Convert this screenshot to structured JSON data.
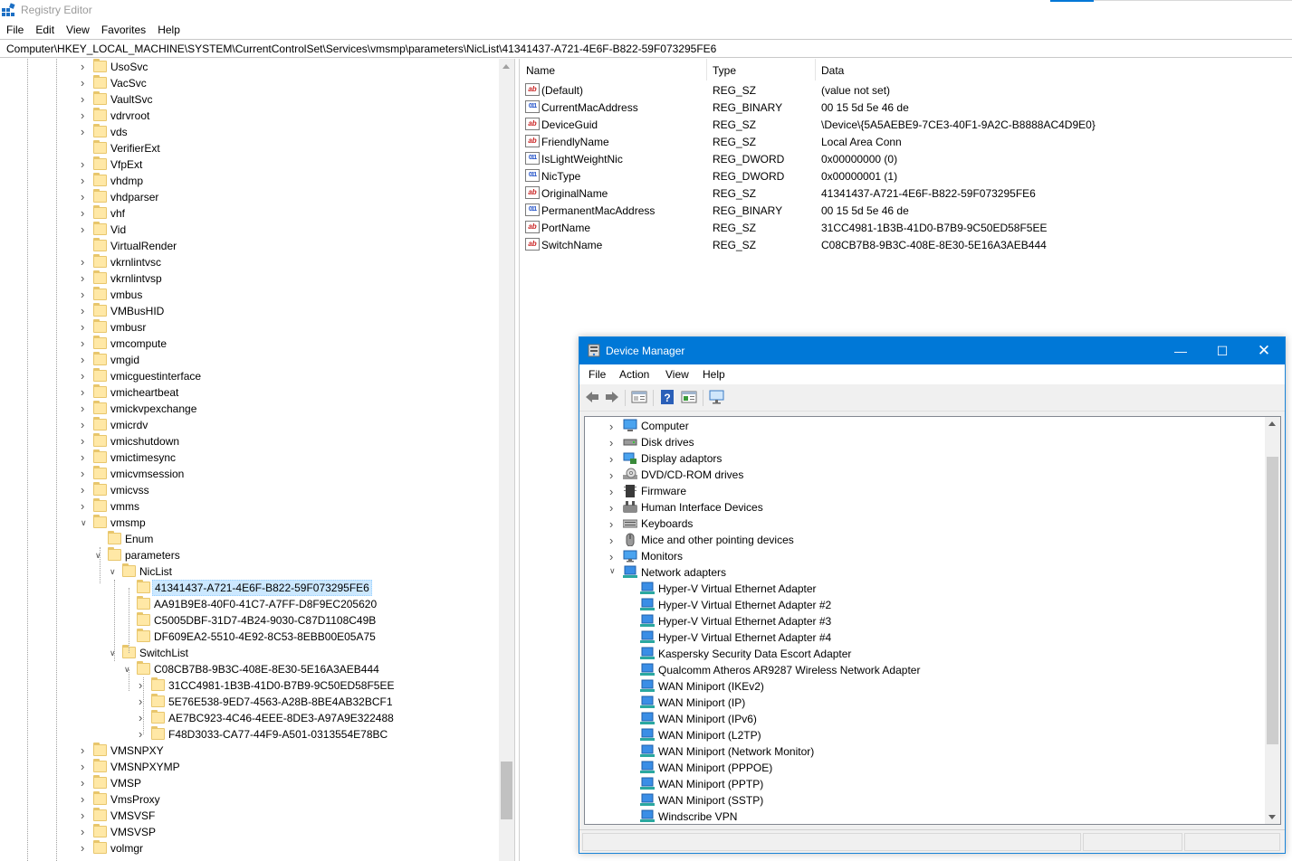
{
  "registry": {
    "title": "Registry Editor",
    "menu": [
      "File",
      "Edit",
      "View",
      "Favorites",
      "Help"
    ],
    "address": "Computer\\HKEY_LOCAL_MACHINE\\SYSTEM\\CurrentControlSet\\Services\\vmsmp\\parameters\\NicList\\41341437-A721-4E6F-B822-59F073295FE6",
    "tree": [
      {
        "label": "UsoSvc",
        "level": 0,
        "exp": "right"
      },
      {
        "label": "VacSvc",
        "level": 0,
        "exp": "right"
      },
      {
        "label": "VaultSvc",
        "level": 0,
        "exp": "right"
      },
      {
        "label": "vdrvroot",
        "level": 0,
        "exp": "right"
      },
      {
        "label": "vds",
        "level": 0,
        "exp": "right"
      },
      {
        "label": "VerifierExt",
        "level": 0,
        "exp": "none"
      },
      {
        "label": "VfpExt",
        "level": 0,
        "exp": "right"
      },
      {
        "label": "vhdmp",
        "level": 0,
        "exp": "right"
      },
      {
        "label": "vhdparser",
        "level": 0,
        "exp": "right"
      },
      {
        "label": "vhf",
        "level": 0,
        "exp": "right"
      },
      {
        "label": "Vid",
        "level": 0,
        "exp": "right"
      },
      {
        "label": "VirtualRender",
        "level": 0,
        "exp": "none"
      },
      {
        "label": "vkrnlintvsc",
        "level": 0,
        "exp": "right"
      },
      {
        "label": "vkrnlintvsp",
        "level": 0,
        "exp": "right"
      },
      {
        "label": "vmbus",
        "level": 0,
        "exp": "right"
      },
      {
        "label": "VMBusHID",
        "level": 0,
        "exp": "right"
      },
      {
        "label": "vmbusr",
        "level": 0,
        "exp": "right"
      },
      {
        "label": "vmcompute",
        "level": 0,
        "exp": "right"
      },
      {
        "label": "vmgid",
        "level": 0,
        "exp": "right"
      },
      {
        "label": "vmicguestinterface",
        "level": 0,
        "exp": "right"
      },
      {
        "label": "vmicheartbeat",
        "level": 0,
        "exp": "right"
      },
      {
        "label": "vmickvpexchange",
        "level": 0,
        "exp": "right"
      },
      {
        "label": "vmicrdv",
        "level": 0,
        "exp": "right"
      },
      {
        "label": "vmicshutdown",
        "level": 0,
        "exp": "right"
      },
      {
        "label": "vmictimesync",
        "level": 0,
        "exp": "right"
      },
      {
        "label": "vmicvmsession",
        "level": 0,
        "exp": "right"
      },
      {
        "label": "vmicvss",
        "level": 0,
        "exp": "right"
      },
      {
        "label": "vmms",
        "level": 0,
        "exp": "right"
      },
      {
        "label": "vmsmp",
        "level": 0,
        "exp": "down"
      },
      {
        "label": "Enum",
        "level": 1,
        "exp": "none"
      },
      {
        "label": "parameters",
        "level": 1,
        "exp": "down"
      },
      {
        "label": "NicList",
        "level": 2,
        "exp": "down"
      },
      {
        "label": "41341437-A721-4E6F-B822-59F073295FE6",
        "level": 3,
        "exp": "none",
        "selected": true
      },
      {
        "label": "AA91B9E8-40F0-41C7-A7FF-D8F9EC205620",
        "level": 3,
        "exp": "none"
      },
      {
        "label": "C5005DBF-31D7-4B24-9030-C87D1108C49B",
        "level": 3,
        "exp": "none"
      },
      {
        "label": "DF609EA2-5510-4E92-8C53-8EBB00E05A75",
        "level": 3,
        "exp": "none"
      },
      {
        "label": "SwitchList",
        "level": 2,
        "exp": "down"
      },
      {
        "label": "C08CB7B8-9B3C-408E-8E30-5E16A3AEB444",
        "level": 3,
        "exp": "down"
      },
      {
        "label": "31CC4981-1B3B-41D0-B7B9-9C50ED58F5EE",
        "level": 4,
        "exp": "right"
      },
      {
        "label": "5E76E538-9ED7-4563-A28B-8BE4AB32BCF1",
        "level": 4,
        "exp": "right"
      },
      {
        "label": "AE7BC923-4C46-4EEE-8DE3-A97A9E322488",
        "level": 4,
        "exp": "right"
      },
      {
        "label": "F48D3033-CA77-44F9-A501-0313554E78BC",
        "level": 4,
        "exp": "right"
      },
      {
        "label": "VMSNPXY",
        "level": 0,
        "exp": "right"
      },
      {
        "label": "VMSNPXYMP",
        "level": 0,
        "exp": "right"
      },
      {
        "label": "VMSP",
        "level": 0,
        "exp": "right"
      },
      {
        "label": "VmsProxy",
        "level": 0,
        "exp": "right"
      },
      {
        "label": "VMSVSF",
        "level": 0,
        "exp": "right"
      },
      {
        "label": "VMSVSP",
        "level": 0,
        "exp": "right"
      },
      {
        "label": "volmgr",
        "level": 0,
        "exp": "right"
      }
    ],
    "columns": {
      "name": "Name",
      "type": "Type",
      "data": "Data"
    },
    "values": [
      {
        "icon": "string-value-icon",
        "kind": "sz",
        "name": "(Default)",
        "type": "REG_SZ",
        "data": "(value not set)"
      },
      {
        "icon": "binary-value-icon",
        "kind": "bin",
        "name": "CurrentMacAddress",
        "type": "REG_BINARY",
        "data": "00 15 5d 5e 46 de"
      },
      {
        "icon": "string-value-icon",
        "kind": "sz",
        "name": "DeviceGuid",
        "type": "REG_SZ",
        "data": "\\Device\\{5A5AEBE9-7CE3-40F1-9A2C-B8888AC4D9E0}"
      },
      {
        "icon": "string-value-icon",
        "kind": "sz",
        "name": "FriendlyName",
        "type": "REG_SZ",
        "data": "Local Area Conn"
      },
      {
        "icon": "binary-value-icon",
        "kind": "bin",
        "name": "IsLightWeightNic",
        "type": "REG_DWORD",
        "data": "0x00000000 (0)"
      },
      {
        "icon": "binary-value-icon",
        "kind": "bin",
        "name": "NicType",
        "type": "REG_DWORD",
        "data": "0x00000001 (1)"
      },
      {
        "icon": "string-value-icon",
        "kind": "sz",
        "name": "OriginalName",
        "type": "REG_SZ",
        "data": "41341437-A721-4E6F-B822-59F073295FE6"
      },
      {
        "icon": "binary-value-icon",
        "kind": "bin",
        "name": "PermanentMacAddress",
        "type": "REG_BINARY",
        "data": "00 15 5d 5e 46 de"
      },
      {
        "icon": "string-value-icon",
        "kind": "sz",
        "name": "PortName",
        "type": "REG_SZ",
        "data": "31CC4981-1B3B-41D0-B7B9-9C50ED58F5EE"
      },
      {
        "icon": "string-value-icon",
        "kind": "sz",
        "name": "SwitchName",
        "type": "REG_SZ",
        "data": "C08CB7B8-9B3C-408E-8E30-5E16A3AEB444"
      }
    ]
  },
  "device_manager": {
    "title": "Device Manager",
    "menu": [
      "File",
      "Action",
      "View",
      "Help"
    ],
    "toolbar_icons": [
      "back-arrow-icon",
      "forward-arrow-icon",
      "properties-icon",
      "help-icon",
      "view-icon",
      "monitor-scan-icon"
    ],
    "categories": [
      {
        "label": "Computer",
        "icon": "computer-icon",
        "exp": "right"
      },
      {
        "label": "Disk drives",
        "icon": "disk-drive-icon",
        "exp": "right"
      },
      {
        "label": "Display adaptors",
        "icon": "display-adapter-icon",
        "exp": "right"
      },
      {
        "label": "DVD/CD-ROM drives",
        "icon": "dvd-drive-icon",
        "exp": "right"
      },
      {
        "label": "Firmware",
        "icon": "firmware-icon",
        "exp": "right"
      },
      {
        "label": "Human Interface Devices",
        "icon": "hid-icon",
        "exp": "right"
      },
      {
        "label": "Keyboards",
        "icon": "keyboard-icon",
        "exp": "right"
      },
      {
        "label": "Mice and other pointing devices",
        "icon": "mouse-icon",
        "exp": "right"
      },
      {
        "label": "Monitors",
        "icon": "monitor-icon",
        "exp": "right"
      },
      {
        "label": "Network adapters",
        "icon": "network-adapter-icon",
        "exp": "down"
      }
    ],
    "adapters": [
      "Hyper-V Virtual Ethernet Adapter",
      "Hyper-V Virtual Ethernet Adapter #2",
      "Hyper-V Virtual Ethernet Adapter #3",
      "Hyper-V Virtual Ethernet Adapter #4",
      "Kaspersky Security Data Escort Adapter",
      "Qualcomm Atheros AR9287 Wireless Network Adapter",
      "WAN Miniport (IKEv2)",
      "WAN Miniport (IP)",
      "WAN Miniport (IPv6)",
      "WAN Miniport (L2TP)",
      "WAN Miniport (Network Monitor)",
      "WAN Miniport (PPPOE)",
      "WAN Miniport (PPTP)",
      "WAN Miniport (SSTP)",
      "Windscribe VPN"
    ]
  }
}
